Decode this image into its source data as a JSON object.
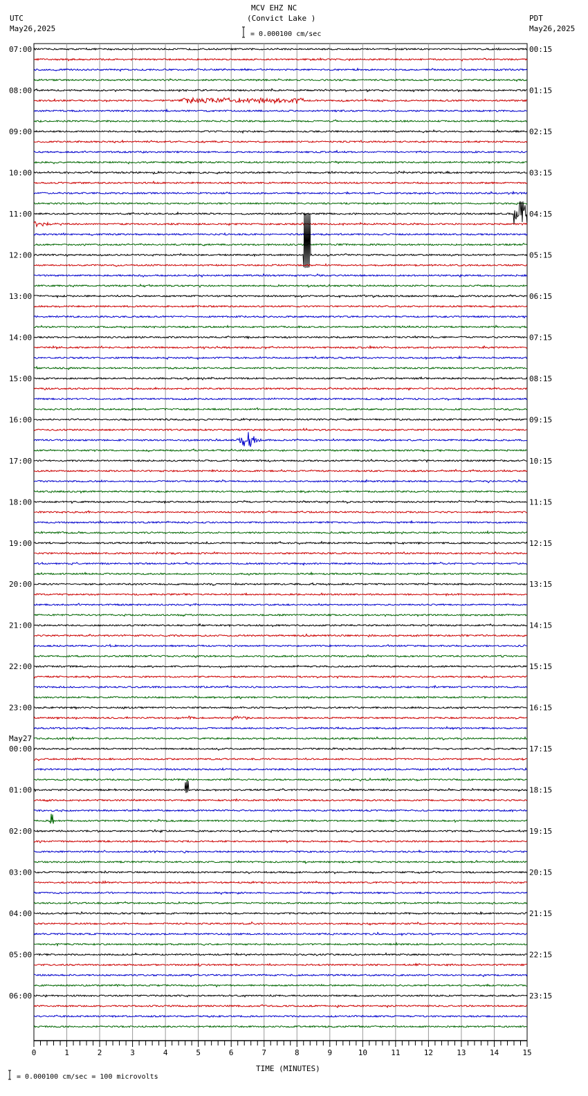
{
  "header": {
    "title": "MCV EHZ NC",
    "subtitle": "(Convict Lake )",
    "left_tz": "UTC",
    "left_date": "May26,2025",
    "right_tz": "PDT",
    "right_date": "May26,2025",
    "scale_text": "= 0.000100 cm/sec"
  },
  "footer": {
    "scale_text": "= 0.000100 cm/sec =     100 microvolts"
  },
  "chart_data": {
    "type": "line",
    "title": "MCV EHZ NC (Convict Lake )",
    "xlabel": "TIME (MINUTES)",
    "xlim": [
      0,
      15
    ],
    "x_ticks": [
      "0",
      "1",
      "2",
      "3",
      "4",
      "5",
      "6",
      "7",
      "8",
      "9",
      "10",
      "11",
      "12",
      "13",
      "14",
      "15"
    ],
    "traces_per_hour": 4,
    "trace_colors": [
      "#000000",
      "#cc0000",
      "#0000cc",
      "#006600"
    ],
    "left_labels": [
      "07:00",
      "08:00",
      "09:00",
      "10:00",
      "11:00",
      "12:00",
      "13:00",
      "14:00",
      "15:00",
      "16:00",
      "17:00",
      "18:00",
      "19:00",
      "20:00",
      "21:00",
      "22:00",
      "23:00",
      "00:00",
      "01:00",
      "02:00",
      "03:00",
      "04:00",
      "05:00",
      "06:00"
    ],
    "date_change_label": "May27",
    "right_labels": [
      "00:15",
      "01:15",
      "02:15",
      "03:15",
      "04:15",
      "05:15",
      "06:15",
      "07:15",
      "08:15",
      "09:15",
      "10:15",
      "11:15",
      "12:15",
      "13:15",
      "14:15",
      "15:15",
      "16:15",
      "17:15",
      "18:15",
      "19:15",
      "20:15",
      "21:15",
      "22:15",
      "23:15"
    ],
    "events": [
      {
        "trace": 5,
        "start_min": 4.4,
        "end_min": 8.2,
        "amplitude": 3,
        "shape": "noise"
      },
      {
        "trace": 16,
        "start_min": 14.6,
        "end_min": 15,
        "amplitude": 18,
        "shape": "burst"
      },
      {
        "trace": 17,
        "start_min": 0,
        "end_min": 1.0,
        "amplitude": 6,
        "shape": "decay"
      },
      {
        "trace": 20,
        "start_min": 8.2,
        "end_min": 8.4,
        "amplitude": 60,
        "shape": "spike"
      },
      {
        "trace": 37,
        "start_min": 8.2,
        "end_min": 8.6,
        "amplitude": 3,
        "shape": "decay"
      },
      {
        "trace": 38,
        "start_min": 6.1,
        "end_min": 7.0,
        "amplitude": 12,
        "shape": "quake"
      },
      {
        "trace": 58,
        "start_min": 2.3,
        "end_min": 2.6,
        "amplitude": 4,
        "shape": "decay"
      },
      {
        "trace": 65,
        "start_min": 4.7,
        "end_min": 5.0,
        "amplitude": 3,
        "shape": "decay"
      },
      {
        "trace": 65,
        "start_min": 6.0,
        "end_min": 6.5,
        "amplitude": 2.5,
        "shape": "noise"
      },
      {
        "trace": 67,
        "start_min": 1.1,
        "end_min": 1.4,
        "amplitude": 3,
        "shape": "decay"
      },
      {
        "trace": 72,
        "start_min": 4.6,
        "end_min": 4.7,
        "amplitude": 12,
        "shape": "spike"
      },
      {
        "trace": 75,
        "start_min": 0.5,
        "end_min": 0.6,
        "amplitude": 10,
        "shape": "spike"
      },
      {
        "trace": 81,
        "start_min": 8.9,
        "end_min": 9.1,
        "amplitude": 7,
        "shape": "decay"
      },
      {
        "trace": 85,
        "start_min": 6.6,
        "end_min": 6.8,
        "amplitude": 3,
        "shape": "decay"
      },
      {
        "trace": 89,
        "start_min": 5.0,
        "end_min": 5.2,
        "amplitude": 4,
        "shape": "decay"
      },
      {
        "trace": 91,
        "start_min": 2.5,
        "end_min": 2.7,
        "amplitude": 4,
        "shape": "decay"
      }
    ]
  }
}
